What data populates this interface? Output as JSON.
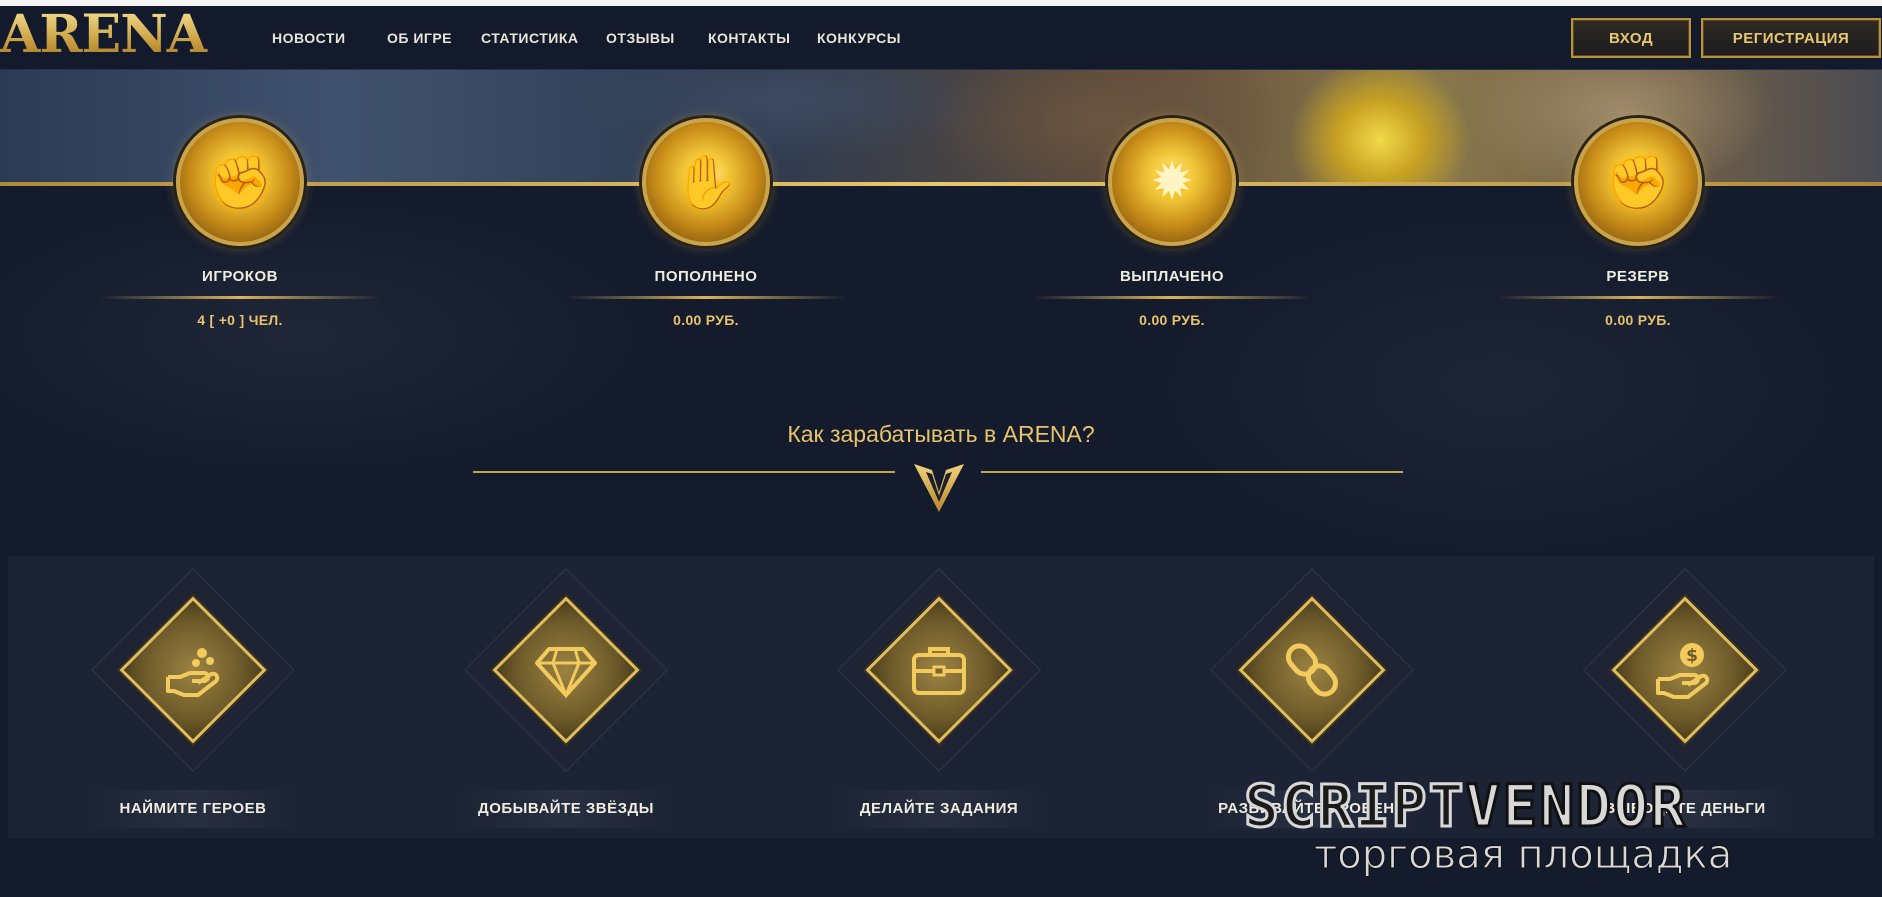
{
  "header": {
    "logo_text": "ARENA",
    "nav": [
      "НОВОСТИ",
      "ОБ ИГРЕ",
      "СТАТИСТИКА",
      "ОТЗЫВЫ",
      "КОНТАКТЫ",
      "КОНКУРСЫ"
    ],
    "login_label": "ВХОД",
    "register_label": "РЕГИСТРАЦИЯ"
  },
  "stats": [
    {
      "label": "ИГРОКОВ",
      "value": "4 [ +0 ] ЧЕЛ.",
      "icon": "fist-punch-icon"
    },
    {
      "label": "ПОПОЛНЕНО",
      "value": "0.00 РУБ.",
      "icon": "gauntlet-icon"
    },
    {
      "label": "ВЫПЛАЧЕНО",
      "value": "0.00 РУБ.",
      "icon": "shield-burst-icon"
    },
    {
      "label": "РЕЗЕРВ",
      "value": "0.00 РУБ.",
      "icon": "armored-fist-icon"
    }
  ],
  "how_to": {
    "title": "Как зарабатывать в ARENA?",
    "steps": [
      {
        "label": "НАЙМИТЕ ГЕРОЕВ",
        "icon": "hand-coins-icon"
      },
      {
        "label": "ДОБЫВАЙТЕ ЗВЁЗДЫ",
        "icon": "diamond-icon"
      },
      {
        "label": "ДЕЛАЙТЕ ЗАДАНИЯ",
        "icon": "briefcase-icon"
      },
      {
        "label": "РАЗВИВАЙТЕ УРОВЕНЬ",
        "icon": "link-icon"
      },
      {
        "label": "ВЫВОДИТЕ ДЕНЬГИ",
        "icon": "hand-dollar-icon"
      }
    ]
  },
  "watermark": {
    "brand_part1": "SCRIPT",
    "brand_part2": "VENDOR",
    "tagline": "торговая площадка"
  },
  "colors": {
    "gold": "#c9a44a",
    "gold_text": "#e8c36a",
    "background": "#141b2c"
  }
}
